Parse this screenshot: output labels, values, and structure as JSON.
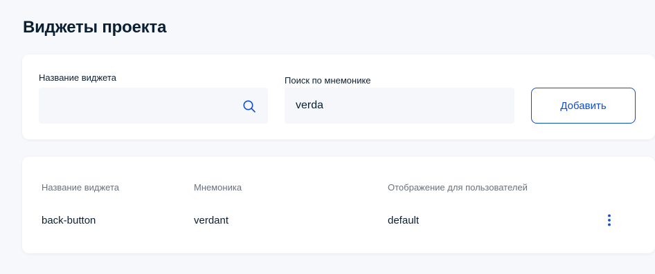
{
  "page": {
    "title": "Виджеты проекта"
  },
  "filters": {
    "widget_name": {
      "label": "Название виджета",
      "value": "",
      "icon": "search-icon"
    },
    "mnemonic_search": {
      "label": "Поиск по мнемонике",
      "value": "verda"
    },
    "add_label": "Добавить"
  },
  "table": {
    "columns": [
      "Название виджета",
      "Мнемоника",
      "Отображение для пользователей"
    ],
    "rows": [
      {
        "name": "back-button",
        "mnemonic": "verdant",
        "display": "default",
        "menu_icon": "more-vertical-icon"
      }
    ]
  },
  "colors": {
    "background": "#f7f8fb",
    "card": "#ffffff",
    "accent": "#0d4cd3",
    "text": "#0b1f33",
    "muted": "#66727f",
    "field": "#f5f7fa"
  }
}
